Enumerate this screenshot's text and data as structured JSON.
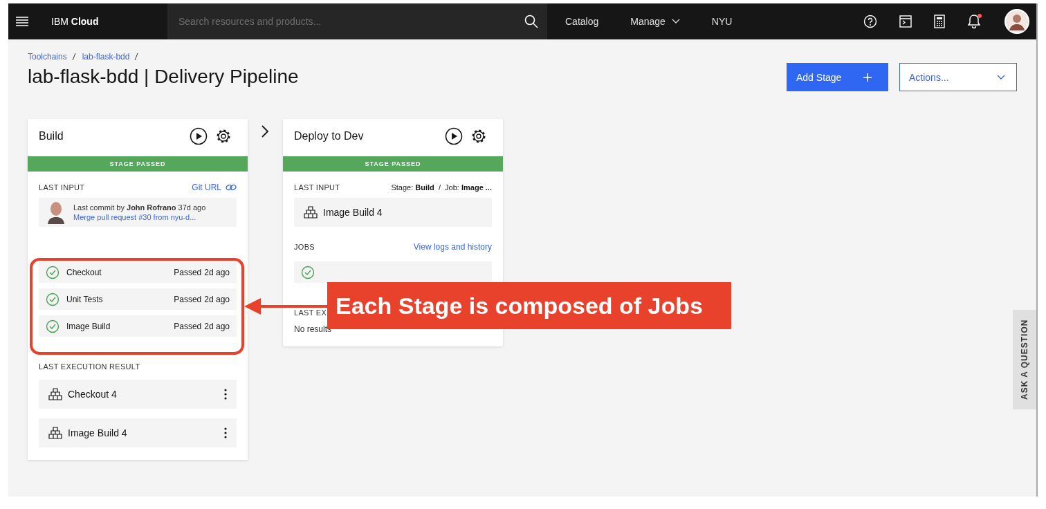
{
  "header": {
    "brand": "IBM **Cloud**",
    "search": {
      "placeholder": "Search resources and products..."
    },
    "nav": [
      {
        "label": "Catalog",
        "dropdown": false
      },
      {
        "label": "Manage",
        "dropdown": true
      },
      {
        "label": "NYU",
        "dropdown": false
      }
    ],
    "notifications": {
      "unread": true
    }
  },
  "breadcrumbs": [
    "Toolchains",
    "lab-flask-bdd"
  ],
  "title": "lab-flask-bdd | Delivery Pipeline",
  "add_stage_button": "Add Stage",
  "actions_dropdown": {
    "label": "Actions..."
  },
  "stages": [
    {
      "name": "Build",
      "status": "STAGE PASSED",
      "passed": true,
      "last_input": {
        "label": "LAST INPUT",
        "kind": "git",
        "source": "Git URL",
        "commit": "Last commit by **John Rofrano** 37d ago",
        "commit_link": "Merge pull request #30 from nyu-d..."
      },
      "jobs": [
        {
          "name": "Checkout",
          "status": "Passed",
          "time": "2d ago",
          "passed": true
        },
        {
          "name": "Unit Tests",
          "status": "Passed",
          "time": "2d ago",
          "passed": true
        },
        {
          "name": "Image Build",
          "status": "Passed",
          "time": "2d ago",
          "passed": true
        }
      ],
      "last_execution": {
        "label": "LAST EXECUTION RESULT",
        "results": [
          "Checkout 4",
          "Image Build 4"
        ]
      }
    },
    {
      "name": "Deploy to Dev",
      "status": "STAGE PASSED",
      "passed": true,
      "last_input": {
        "label": "LAST INPUT",
        "kind": "stage",
        "source": "Stage: **Build**  /  Job: **Image ...**",
        "artifact": "Image Build 4"
      },
      "jobs_header": {
        "label": "JOBS",
        "link": "View logs and history"
      },
      "jobs": [
        {
          "passed": true
        }
      ],
      "last_execution": {
        "label": "LAST EX",
        "empty_text": "No results"
      }
    }
  ],
  "callout": {
    "text": "Each Stage is composed of Jobs"
  },
  "side_tab": "ASK A QUESTION"
}
